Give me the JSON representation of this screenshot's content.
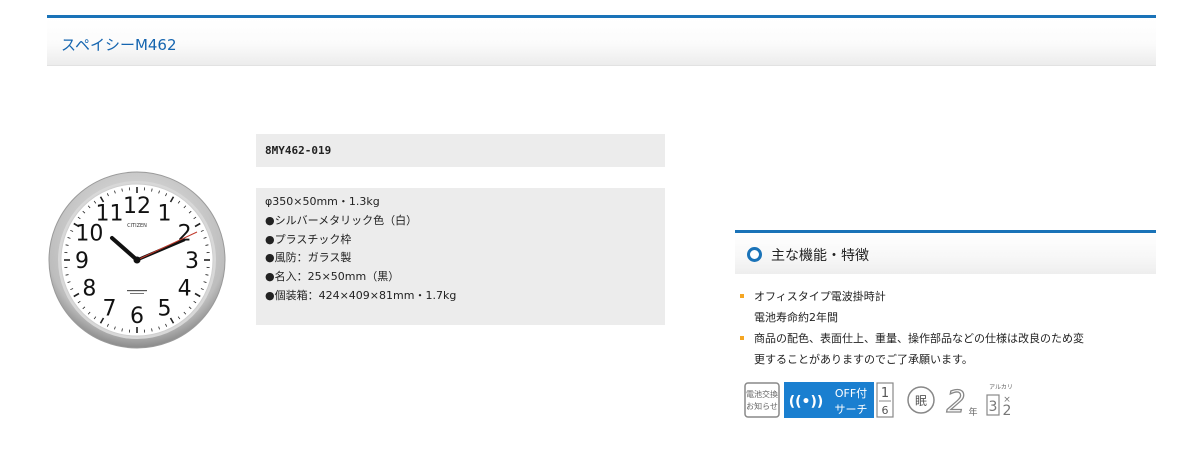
{
  "header": {
    "title": "スペイシーM462"
  },
  "product": {
    "model": "8MY462-019",
    "brand": "CITIZEN",
    "specs": [
      "φ350×50mm・1.3kg",
      "●シルバーメタリック色（白）",
      "●プラスチック枠",
      "●風防：ガラス製",
      "●名入：25×50mm（黒）",
      "●個装箱：424×409×81mm・1.7kg"
    ],
    "clock_numerals": [
      "12",
      "1",
      "2",
      "3",
      "4",
      "5",
      "6",
      "7",
      "8",
      "9",
      "10",
      "11"
    ]
  },
  "features": {
    "heading": "主な機能・特徴",
    "items": [
      {
        "line1": "オフィスタイプ電波掛時計",
        "line2": "電池寿命約2年間"
      },
      {
        "line1": "商品の配色、表面仕上、重量、操作部品などの仕様は改良のため変",
        "line2": "更することがありますのでご了承願います。"
      }
    ]
  },
  "icons": {
    "battery_notice": [
      "電池交換",
      "お知らせ"
    ],
    "radio_wave": "((•))",
    "off_search": [
      "OFF付",
      "サーチ"
    ],
    "off_fraction": [
      "1",
      "6"
    ],
    "sleep": "眠",
    "battery_years": {
      "value": "2",
      "unit": "年"
    },
    "alkaline": {
      "label": "アルカリ",
      "count": "3",
      "size": "2"
    },
    "accent_color": "#1a73b8"
  }
}
